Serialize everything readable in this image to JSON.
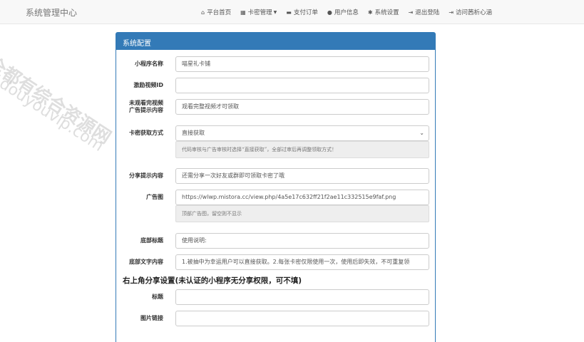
{
  "navbar": {
    "brand": "系统管理中心",
    "items": [
      {
        "label": "平台首页",
        "icon": "home-icon",
        "glyph": "⌂"
      },
      {
        "label": "卡密管理",
        "icon": "grid-icon",
        "glyph": "▦",
        "dropdown": true
      },
      {
        "label": "支付订单",
        "icon": "card-icon",
        "glyph": "▬"
      },
      {
        "label": "用户信息",
        "icon": "user-icon",
        "glyph": "●"
      },
      {
        "label": "系统设置",
        "icon": "gear-icon",
        "glyph": "✱"
      },
      {
        "label": "退出登陆",
        "icon": "logout-icon",
        "glyph": "⇥"
      },
      {
        "label": "访问茜析心涵",
        "icon": "external-link-icon",
        "glyph": "⇥"
      }
    ]
  },
  "panel": {
    "title": "系统配置",
    "fields": {
      "app_name": {
        "label": "小程序名称",
        "value": "喵星礼卡铺"
      },
      "reward_video_id": {
        "label": "激励视频ID",
        "value": ""
      },
      "ad_tip": {
        "label_line1": "未观看完视频",
        "label_line2": "广告提示内容",
        "value": "观看完整视频才可领取"
      },
      "fetch_method": {
        "label": "卡密获取方式",
        "value": "直接获取",
        "help": "代码审核与广告审核时选择“直接获取”，全部过审后再调整领取方式！"
      },
      "share_tip": {
        "label": "分享提示内容",
        "value": "还需分享一次好友或群即可领取卡密了哦"
      },
      "ad_image": {
        "label": "广告图",
        "value": "https://wlwp.mistora.cc/view.php/4a5e17c632ff21f2ae11c332515e9faf.png",
        "help": "顶部广告图，留空则不显示"
      },
      "footer_title": {
        "label": "底部标题",
        "value": "使用说明:"
      },
      "footer_text": {
        "label": "底部文字内容",
        "value": "1.被抽中为幸运用户可以直接获取。2.每张卡密仅限使用一次，使用后即失效，不可重复领"
      }
    },
    "share_section": {
      "title": "右上角分享设置(未认证的小程序无分享权限，可不填)",
      "title_field": {
        "label": "标题",
        "value": ""
      },
      "image_field": {
        "label": "图片链接",
        "value": ""
      }
    }
  },
  "watermark": {
    "line1": "全都有综合资源网",
    "line2": "douyouvip.com"
  }
}
